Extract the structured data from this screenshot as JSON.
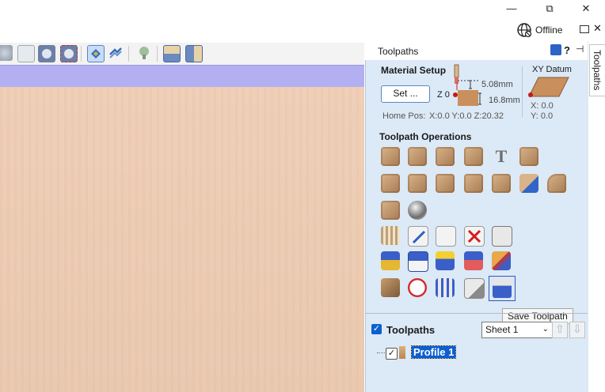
{
  "window": {
    "minimize_glyph": "—",
    "maximize_glyph": "⧉",
    "close_glyph": "✕"
  },
  "status": {
    "connection": "Offline"
  },
  "panel": {
    "title": "Toolpaths",
    "help_glyph": "?",
    "side_tab_label": "Toolpaths",
    "material_setup": {
      "title": "Material Setup",
      "set_button": "Set ...",
      "z_label": "Z 0",
      "top_thickness": "5.08mm",
      "bottom_thickness": "16.8mm",
      "home_pos_label": "Home Pos:",
      "home_pos_value": "X:0.0 Y:0.0 Z:20.32",
      "xy_datum_title": "XY Datum",
      "x_value": "X: 0.0",
      "y_value": "Y: 0.0"
    },
    "operations": {
      "title": "Toolpath Operations",
      "icons": [
        "profile-toolpath-icon",
        "pocket-toolpath-icon",
        "drilling-toolpath-icon",
        "inlay-toolpath-icon",
        "v-carve-toolpath-icon",
        "prism-toolpath-icon",
        "chamfer-toolpath-icon",
        "fluting-toolpath-icon",
        "texture-toolpath-icon",
        "moulding-toolpath-icon",
        "prism-carve-toolpath-icon",
        "roughing-3d-toolpath-icon",
        "finishing-3d-toolpath-icon",
        "3d-profile-toolpath-icon",
        "3d-finish-ball-icon",
        "tool-database-icon",
        "edit-toolpath-icon",
        "merge-toolpaths-icon",
        "delete-toolpath-icon",
        "calculator-icon",
        "template-open-icon",
        "template-save-icon",
        "template-load-icon",
        "template-delete-icon",
        "recalculate-icon",
        "preview-toolpath-icon",
        "time-estimate-icon",
        "toolpath-summary-icon",
        "toolpath-settings-icon",
        "save-toolpath-icon"
      ]
    },
    "tooltip": "Save Toolpath",
    "toolpaths_list": {
      "title": "Toolpaths",
      "sheet_select": "Sheet 1",
      "items": [
        {
          "label": "Profile 1",
          "checked": true
        }
      ]
    }
  },
  "colors": {
    "panel_bg": "#dce9f6",
    "accent": "#0b5fd1",
    "viewbar": "#b3b0f2",
    "wood": "#efcdb5"
  }
}
